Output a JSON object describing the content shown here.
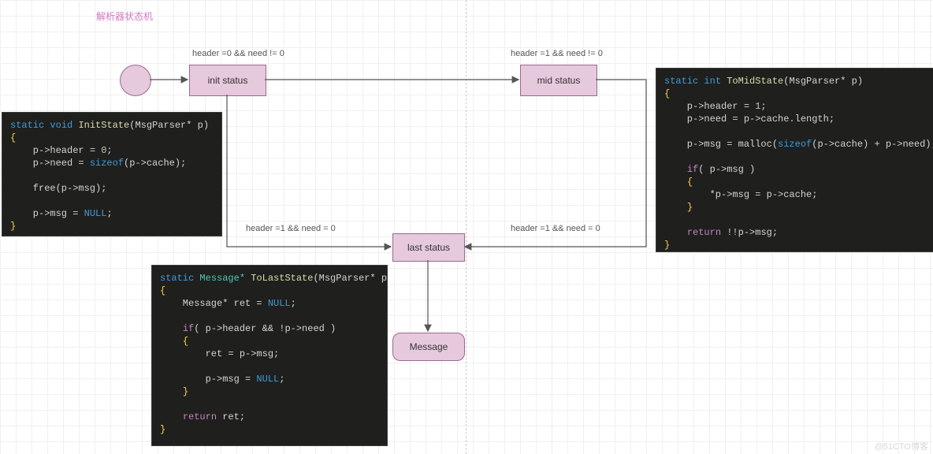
{
  "title": "解析器状态机",
  "watermark": "@51CTO博客",
  "nodes": {
    "init": "init status",
    "mid": "mid status",
    "last": "last status",
    "msg": "Message"
  },
  "edges": {
    "to_init": "header =0 && need != 0",
    "to_mid": "header =1 && need != 0",
    "init_last": "header =1 && need = 0",
    "mid_last": "header =1 && need = 0"
  },
  "code_init": {
    "sig1": "static",
    "sig2": "void",
    "sig3": "InitState",
    "sig4": "(MsgParser* p)",
    "l1": "    p->header = ",
    "l1n": "0",
    "l1e": ";",
    "l2a": "    p->need = ",
    "l2b": "sizeof",
    "l2c": "(p->cache);",
    "l3a": "    free(p->msg);",
    "l4a": "    p->msg = ",
    "l4b": "NULL",
    "l4c": ";"
  },
  "code_mid": {
    "sig1": "static",
    "sig2": "int",
    "sig3": "ToMidState",
    "sig4": "(MsgParser* p)",
    "l1": "    p->header = ",
    "l1n": "1",
    "l1e": ";",
    "l2": "    p->need = p->cache.length;",
    "l3a": "    p->msg = malloc(",
    "l3b": "sizeof",
    "l3c": "(p->cache) + p->need);",
    "l4a": "    ",
    "l4if": "if",
    "l4b": "( p->msg )",
    "l5": "        *p->msg = p->cache;",
    "l6a": "    ",
    "l6r": "return",
    "l6b": " !!p->msg;"
  },
  "code_last": {
    "sig1": "static",
    "sig2": "Message*",
    "sig3": "ToLastState",
    "sig4": "(MsgParser* p)",
    "l1a": "    Message* ret = ",
    "l1b": "NULL",
    "l1c": ";",
    "l2a": "    ",
    "l2if": "if",
    "l2b": "( p->header && !p->need )",
    "l3": "        ret = p->msg;",
    "l4a": "        p->msg = ",
    "l4b": "NULL",
    "l4c": ";",
    "l5a": "    ",
    "l5r": "return",
    "l5b": " ret;"
  }
}
